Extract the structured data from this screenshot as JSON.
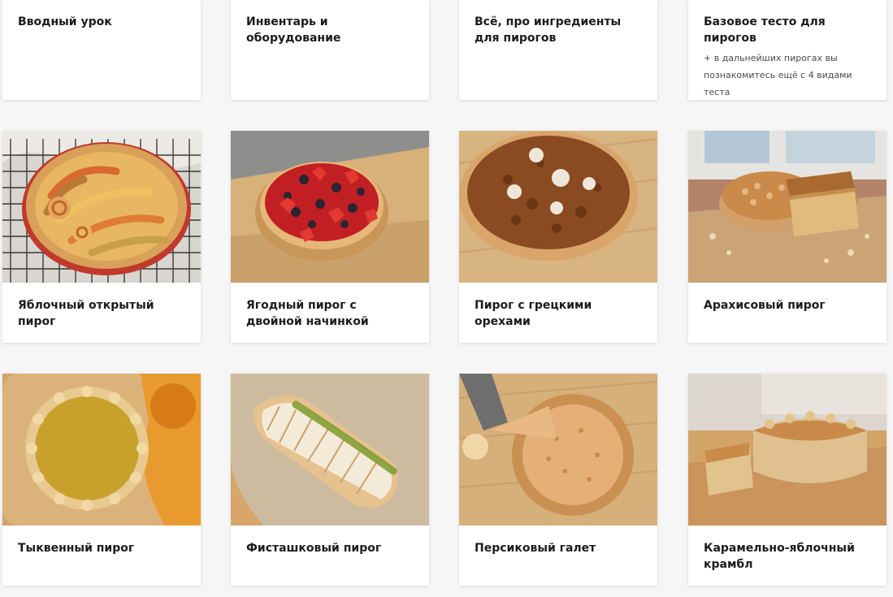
{
  "lessons": [
    {
      "title": "Вводный урок"
    },
    {
      "title": "Инвентарь и оборудование"
    },
    {
      "title": "Всё, про ингредиенты для пирогов"
    },
    {
      "title": "Базовое тесто для пирогов",
      "note": "+ в дальнейших пирогах вы познакомитесь ещё с 4 видами теста"
    },
    {
      "title": "Яблочный открытый пирог",
      "image": "apple-tart-photo"
    },
    {
      "title": "Ягодный пирог с двойной начинкой",
      "image": "berry-tart-photo"
    },
    {
      "title": "Пирог с грецкими орехами",
      "image": "walnut-pie-photo"
    },
    {
      "title": "Арахисовый пирог",
      "image": "peanut-pie-photo"
    },
    {
      "title": "Тыквенный пирог",
      "image": "pumpkin-pie-photo"
    },
    {
      "title": "Фисташковый пирог",
      "image": "pistachio-strudel-photo"
    },
    {
      "title": "Персиковый галет",
      "image": "peach-galette-photo"
    },
    {
      "title": "Карамельно-яблочный крамбл",
      "image": "caramel-apple-crumble-photo"
    }
  ]
}
